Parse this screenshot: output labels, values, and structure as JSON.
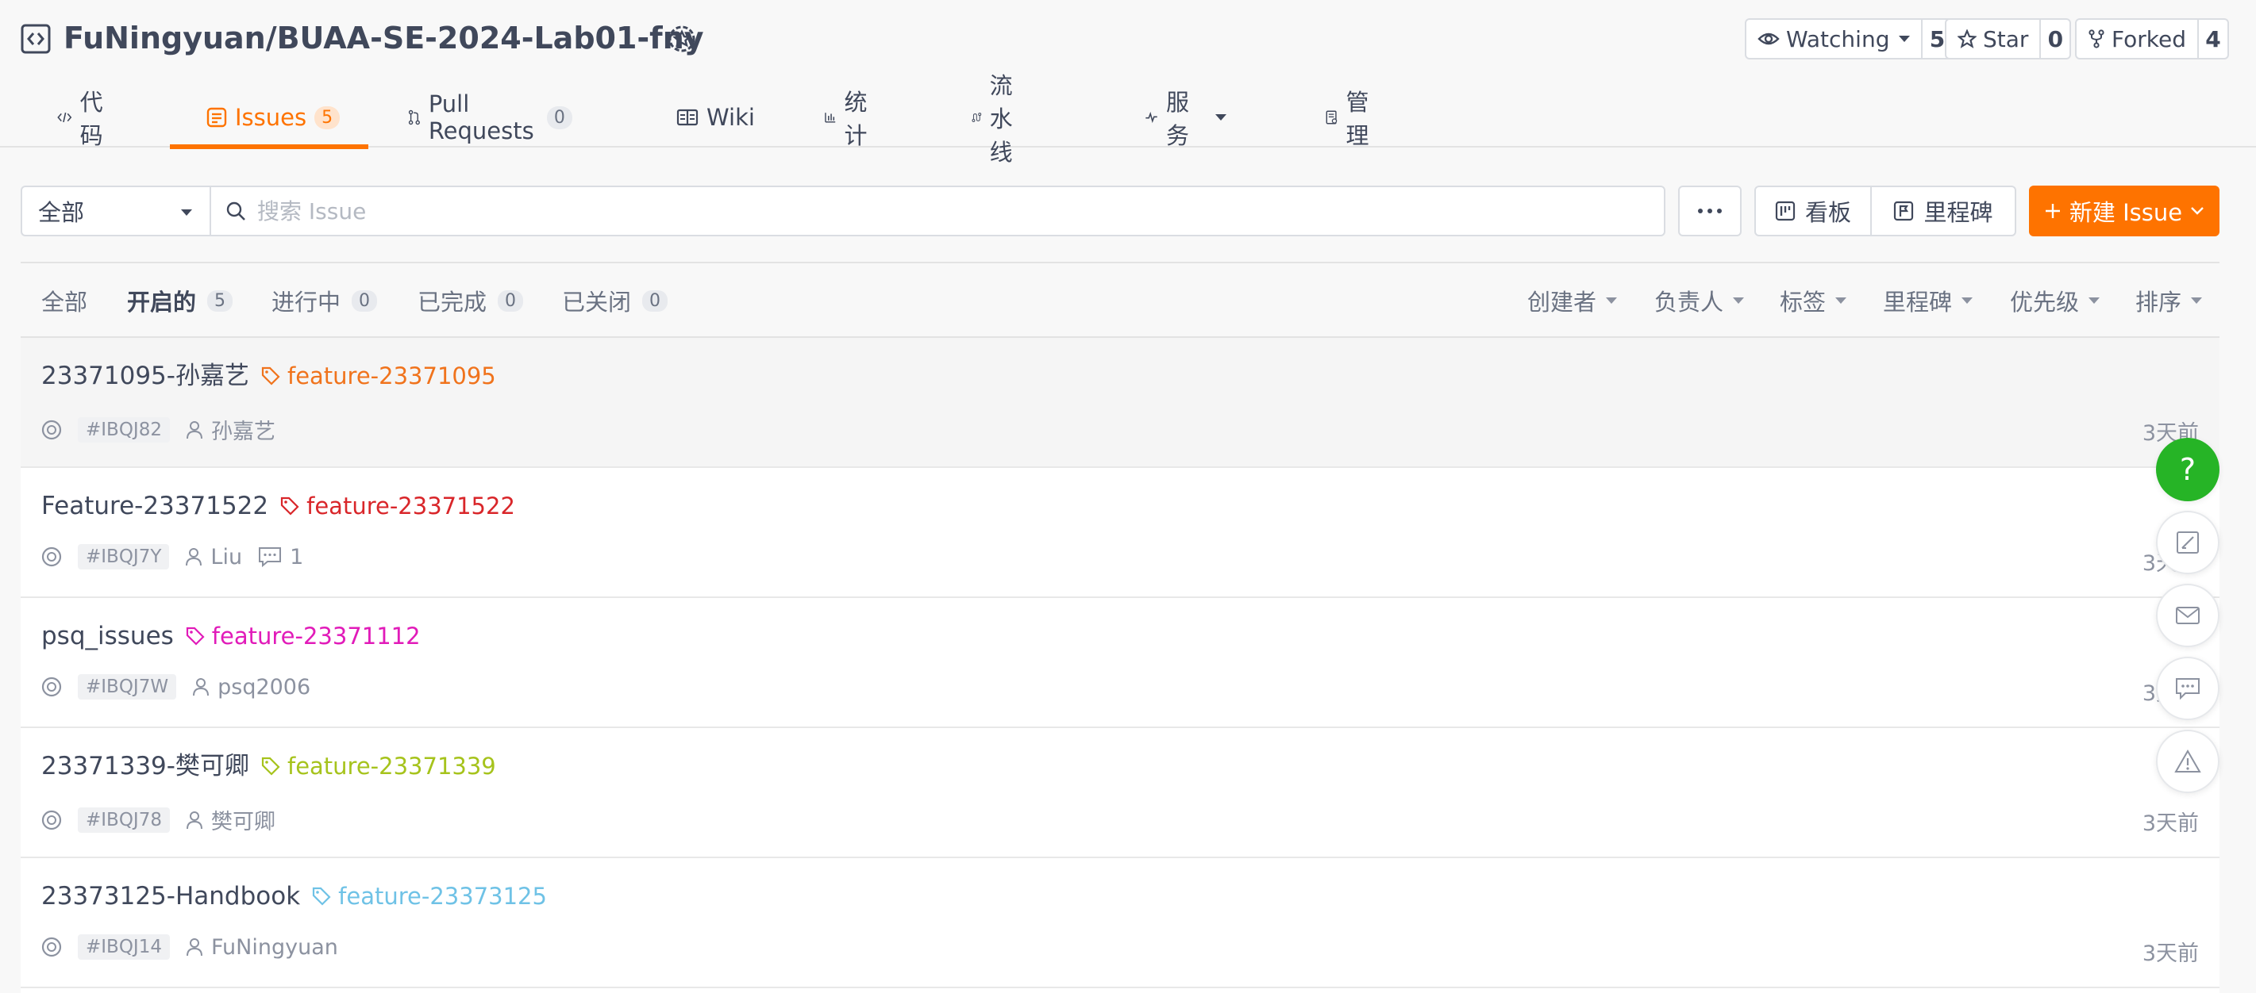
{
  "repo": {
    "name": "FuNingyuan/BUAA-SE-2024-Lab01-fny"
  },
  "actions": {
    "watching": {
      "label": "Watching",
      "count": "5"
    },
    "star": {
      "label": "Star",
      "count": "0"
    },
    "forked": {
      "label": "Forked",
      "count": "4"
    }
  },
  "tabs": [
    {
      "label": "代码",
      "icon": "code-icon"
    },
    {
      "label": "Issues",
      "count": "5",
      "icon": "issues-icon",
      "active": true
    },
    {
      "label": "Pull Requests",
      "count": "0",
      "icon": "pull-request-icon"
    },
    {
      "label": "Wiki",
      "icon": "wiki-icon"
    },
    {
      "label": "统计",
      "icon": "chart-icon"
    },
    {
      "label": "流水线",
      "icon": "pipeline-icon"
    },
    {
      "label": "服务",
      "icon": "pulse-icon"
    },
    {
      "label": "管理",
      "icon": "manage-icon"
    }
  ],
  "toolbar": {
    "filter_value": "全部",
    "search_placeholder": "搜索 Issue",
    "board_label": "看板",
    "milestone_label": "里程碑",
    "new_issue_label": "新建 Issue"
  },
  "status_tabs": [
    {
      "label": "全部"
    },
    {
      "label": "开启的",
      "count": "5"
    },
    {
      "label": "进行中",
      "count": "0"
    },
    {
      "label": "已完成",
      "count": "0"
    },
    {
      "label": "已关闭",
      "count": "0"
    }
  ],
  "sort_filters": [
    "创建者",
    "负责人",
    "标签",
    "里程碑",
    "优先级",
    "排序"
  ],
  "issues": [
    {
      "title": "23371095-孙嘉艺",
      "label": "feature-23371095",
      "label_color": "#f0731c",
      "id": "#IBQJ82",
      "author": "孙嘉艺",
      "comments": "",
      "time": "3天前"
    },
    {
      "title": "Feature-23371522",
      "label": "feature-23371522",
      "label_color": "#d9262a",
      "id": "#IBQJ7Y",
      "author": "Liu",
      "comments": "1",
      "time": "3天前"
    },
    {
      "title": "psq_issues",
      "label": "feature-23371112",
      "label_color": "#e11bb9",
      "id": "#IBQJ7W",
      "author": "psq2006",
      "comments": "",
      "time": "3天前"
    },
    {
      "title": "23371339-樊可卿",
      "label": "feature-23371339",
      "label_color": "#a6c31c",
      "id": "#IBQJ78",
      "author": "樊可卿",
      "comments": "",
      "time": "3天前"
    },
    {
      "title": "23373125-Handbook",
      "label": "feature-23373125",
      "label_color": "#6fc2e6",
      "id": "#IBQJ14",
      "author": "FuNingyuan",
      "comments": "",
      "time": "3天前"
    }
  ],
  "float_buttons": [
    {
      "icon": "help-icon",
      "text": "?"
    },
    {
      "icon": "edit-icon"
    },
    {
      "icon": "mail-icon"
    },
    {
      "icon": "chat-icon"
    },
    {
      "icon": "warning-icon"
    }
  ],
  "colors": {
    "accent": "#fe7300",
    "help": "#26b426",
    "text": "#40485b"
  }
}
